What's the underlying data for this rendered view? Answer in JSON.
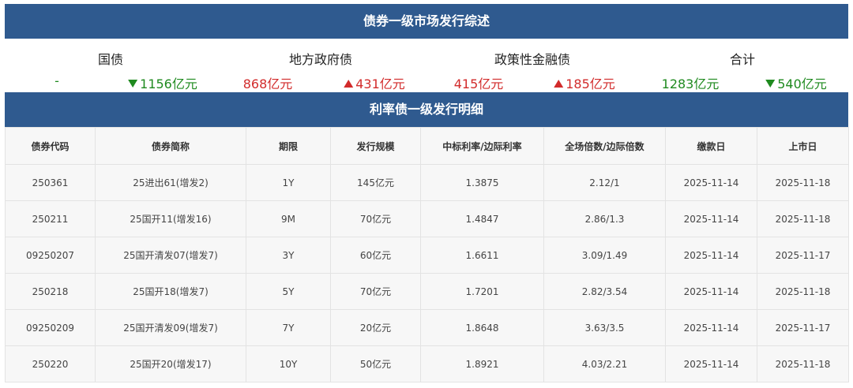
{
  "title_primary": "债券一级市场发行综述",
  "summary": {
    "labels": [
      "国债",
      "地方政府债",
      "政策性金融债",
      "合计"
    ],
    "values": [
      {
        "text": "-",
        "color": "green",
        "arrow": ""
      },
      {
        "text": "1156亿元",
        "color": "green",
        "arrow": "down"
      },
      {
        "text": "868亿元",
        "color": "red",
        "arrow": ""
      },
      {
        "text": "431亿元",
        "color": "red",
        "arrow": "up"
      },
      {
        "text": "415亿元",
        "color": "red",
        "arrow": ""
      },
      {
        "text": "185亿元",
        "color": "red",
        "arrow": "up"
      },
      {
        "text": "1283亿元",
        "color": "green",
        "arrow": ""
      },
      {
        "text": "540亿元",
        "color": "green",
        "arrow": "down"
      }
    ]
  },
  "title_detail": "利率债一级发行明细",
  "table": {
    "headers": [
      "债券代码",
      "债券简称",
      "期限",
      "发行规模",
      "中标利率/边际利率",
      "全场倍数/边际倍数",
      "缴款日",
      "上市日"
    ],
    "rows": [
      [
        "250361",
        "25进出61(增发2)",
        "1Y",
        "145亿元",
        "1.3875",
        "2.12/1",
        "2025-11-14",
        "2025-11-18"
      ],
      [
        "250211",
        "25国开11(增发16)",
        "9M",
        "70亿元",
        "1.4847",
        "2.86/1.3",
        "2025-11-14",
        "2025-11-18"
      ],
      [
        "09250207",
        "25国开清发07(增发7)",
        "3Y",
        "60亿元",
        "1.6611",
        "3.09/1.49",
        "2025-11-14",
        "2025-11-17"
      ],
      [
        "250218",
        "25国开18(增发7)",
        "5Y",
        "70亿元",
        "1.7201",
        "2.82/3.54",
        "2025-11-14",
        "2025-11-18"
      ],
      [
        "09250209",
        "25国开清发09(增发7)",
        "7Y",
        "20亿元",
        "1.8648",
        "3.63/3.5",
        "2025-11-14",
        "2025-11-17"
      ],
      [
        "250220",
        "25国开20(增发17)",
        "10Y",
        "50亿元",
        "1.8921",
        "4.03/2.21",
        "2025-11-14",
        "2025-11-18"
      ]
    ]
  },
  "colors": {
    "banner": "#2f5a8f",
    "up": "#d22b2b",
    "down": "#1f8a1f"
  }
}
